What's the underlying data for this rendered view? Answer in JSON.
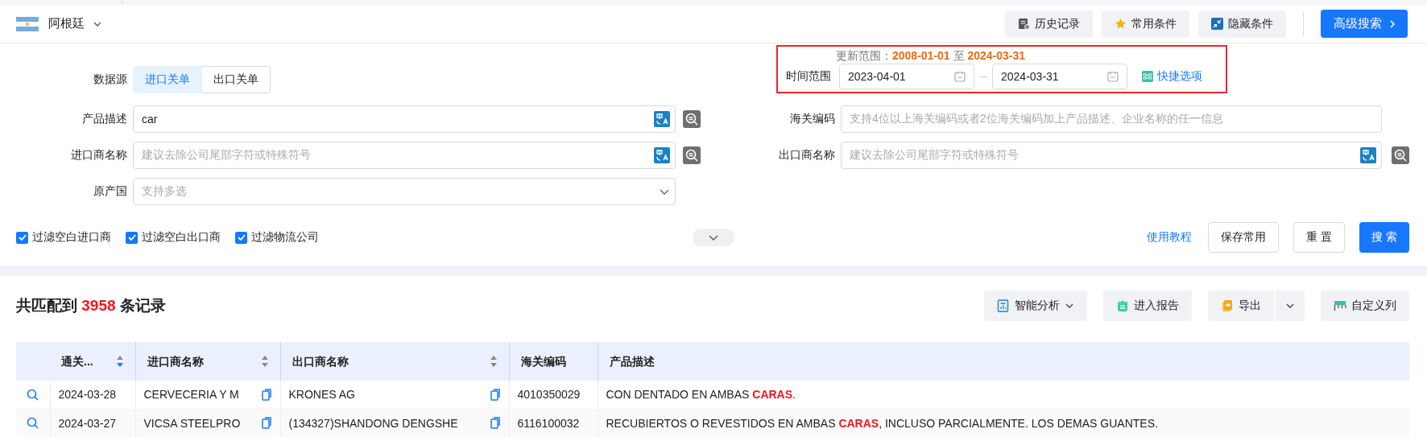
{
  "header": {
    "country": "阿根廷",
    "buttons": [
      {
        "label": "历史记录",
        "kind": "history"
      },
      {
        "label": "常用条件",
        "kind": "star"
      },
      {
        "label": "隐藏条件",
        "kind": "collapse"
      }
    ],
    "primary_button": "高级搜索"
  },
  "data_source": {
    "label": "数据源",
    "options": [
      {
        "label": "进口关单",
        "selected": true
      },
      {
        "label": "出口关单",
        "selected": false
      }
    ]
  },
  "update_range": {
    "prefix": "更新范围：",
    "start": "2008-01-01",
    "separator": "至",
    "end": "2024-03-31"
  },
  "time_range": {
    "label": "时间范围",
    "start": "2023-04-01",
    "end": "2024-03-31",
    "quick_link": "快捷选项"
  },
  "left_fields": [
    {
      "label": "产品描述",
      "kind": "text",
      "value": "car",
      "translate": true,
      "lookup": true
    },
    {
      "label": "进口商名称",
      "kind": "text",
      "placeholder": "建议去除公司尾部字符或特殊符号",
      "translate": true,
      "lookup": true
    },
    {
      "label": "原产国",
      "kind": "select",
      "placeholder": "支持多选",
      "translate": false,
      "lookup": false
    }
  ],
  "right_fields": [
    {
      "label": "海关编码",
      "kind": "text",
      "placeholder": "支持4位以上海关编码或者2位海关编码加上产品描述、企业名称的任一信息",
      "translate": false,
      "lookup": false
    },
    {
      "label": "出口商名称",
      "kind": "text",
      "placeholder": "建议去除公司尾部字符或特殊符号",
      "translate": true,
      "lookup": true
    }
  ],
  "filters": [
    {
      "label": "过滤空白进口商",
      "checked": true
    },
    {
      "label": "过滤空白出口商",
      "checked": true
    },
    {
      "label": "过滤物流公司",
      "checked": true
    }
  ],
  "tutorial_link": "使用教程",
  "actions": [
    {
      "label": "保存常用",
      "kind": "default"
    },
    {
      "label": "重 置",
      "kind": "default"
    },
    {
      "label": "搜 索",
      "kind": "primary"
    }
  ],
  "results": {
    "prefix": "共匹配到",
    "count": "3958",
    "suffix": "条记录"
  },
  "tools": [
    {
      "label": "智能分析",
      "kind": "bi"
    },
    {
      "label": "进入报告",
      "kind": "report"
    },
    {
      "label": "导出",
      "kind": "export"
    },
    {
      "label": "自定义列",
      "kind": "columns"
    }
  ],
  "table": {
    "columns": [
      {
        "label": "通关...",
        "sortable": true,
        "sorted_descending": true,
        "copy": false
      },
      {
        "label": "进口商名称",
        "sortable": true,
        "sorted_descending": false,
        "copy": true
      },
      {
        "label": "出口商名称",
        "sortable": true,
        "sorted_descending": false,
        "copy": true
      },
      {
        "label": "海关编码",
        "sortable": false,
        "copy": false
      },
      {
        "label": "产品描述",
        "sortable": false,
        "copy": false
      }
    ],
    "rows": [
      {
        "cells": [
          "2024-03-28",
          "CERVECERIA Y M",
          "KRONES AG",
          "4010350029",
          "CON DENTADO EN AMBAS **CARAS**."
        ]
      },
      {
        "cells": [
          "2024-03-27",
          "VICSA STEELPRO",
          "(134327)SHANDONG DENGSHE",
          "6116100032",
          "RECUBIERTOS O REVESTIDOS EN AMBAS **CARAS**, INCLUSO PARCIALMENTE. LOS DEMAS GUANTES."
        ]
      }
    ]
  }
}
